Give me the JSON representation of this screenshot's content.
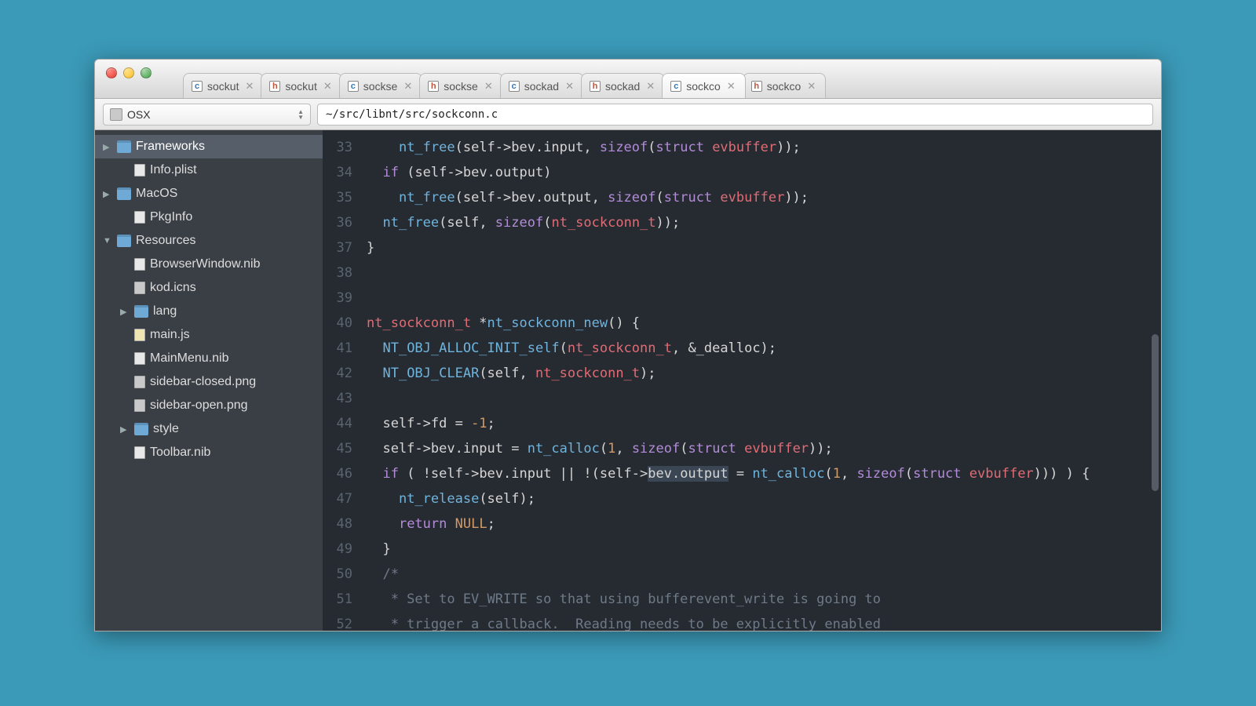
{
  "selector": {
    "label": "OSX"
  },
  "path": "~/src/libnt/src/sockconn.c",
  "tabs": [
    {
      "label": "sockut",
      "type": "c",
      "active": false
    },
    {
      "label": "sockut",
      "type": "h",
      "active": false
    },
    {
      "label": "sockse",
      "type": "c",
      "active": false
    },
    {
      "label": "sockse",
      "type": "h",
      "active": false
    },
    {
      "label": "sockad",
      "type": "c",
      "active": false
    },
    {
      "label": "sockad",
      "type": "h",
      "active": false
    },
    {
      "label": "sockco",
      "type": "c",
      "active": true
    },
    {
      "label": "sockco",
      "type": "h",
      "active": false
    }
  ],
  "sidebar": [
    {
      "label": "Frameworks",
      "kind": "folder",
      "depth": 0,
      "arrow": "right",
      "selected": true
    },
    {
      "label": "Info.plist",
      "kind": "file",
      "depth": 1,
      "arrow": ""
    },
    {
      "label": "MacOS",
      "kind": "folder",
      "depth": 0,
      "arrow": "right"
    },
    {
      "label": "PkgInfo",
      "kind": "file",
      "depth": 1,
      "arrow": ""
    },
    {
      "label": "Resources",
      "kind": "folder",
      "depth": 0,
      "arrow": "down"
    },
    {
      "label": "BrowserWindow.nib",
      "kind": "file",
      "depth": 1,
      "arrow": ""
    },
    {
      "label": "kod.icns",
      "kind": "filedark",
      "depth": 1,
      "arrow": ""
    },
    {
      "label": "lang",
      "kind": "folder",
      "depth": 1,
      "arrow": "right"
    },
    {
      "label": "main.js",
      "kind": "js",
      "depth": 1,
      "arrow": ""
    },
    {
      "label": "MainMenu.nib",
      "kind": "file",
      "depth": 1,
      "arrow": ""
    },
    {
      "label": "sidebar-closed.png",
      "kind": "filedark",
      "depth": 1,
      "arrow": ""
    },
    {
      "label": "sidebar-open.png",
      "kind": "filedark",
      "depth": 1,
      "arrow": ""
    },
    {
      "label": "style",
      "kind": "folder",
      "depth": 1,
      "arrow": "right"
    },
    {
      "label": "Toolbar.nib",
      "kind": "file",
      "depth": 1,
      "arrow": ""
    }
  ],
  "gutter_start": 33,
  "code_lines": [
    "    <span class='c-fn'>nt_free</span>(self-&gt;bev.input, <span class='c-kw'>sizeof</span>(<span class='c-kw'>struct</span> <span class='c-tp'>evbuffer</span>));",
    "  <span class='c-kw'>if</span> (self-&gt;bev.output)",
    "    <span class='c-fn'>nt_free</span>(self-&gt;bev.output, <span class='c-kw'>sizeof</span>(<span class='c-kw'>struct</span> <span class='c-tp'>evbuffer</span>));",
    "  <span class='c-fn'>nt_free</span>(self, <span class='c-kw'>sizeof</span>(<span class='c-tp'>nt_sockconn_t</span>));",
    "}",
    "",
    "",
    "<span class='c-tp'>nt_sockconn_t</span> *<span class='c-fn'>nt_sockconn_new</span>() {",
    "  <span class='c-fn'>NT_OBJ_ALLOC_INIT_self</span>(<span class='c-tp'>nt_sockconn_t</span>, &amp;_dealloc);",
    "  <span class='c-fn'>NT_OBJ_CLEAR</span>(self, <span class='c-tp'>nt_sockconn_t</span>);",
    "",
    "  self-&gt;fd = <span class='c-num'>-1</span>;",
    "  self-&gt;bev.input = <span class='c-fn'>nt_calloc</span>(<span class='c-num'>1</span>, <span class='c-kw'>sizeof</span>(<span class='c-kw'>struct</span> <span class='c-tp'>evbuffer</span>));",
    "  <span class='c-kw'>if</span> ( !self-&gt;bev.input || !(self-&gt;<span class='c-hl'>bev.output</span> = <span class='c-fn'>nt_calloc</span>(<span class='c-num'>1</span>, <span class='c-kw'>sizeof</span>(<span class='c-kw'>struct</span> <span class='c-tp'>evbuffer</span>))) ) {",
    "    <span class='c-fn'>nt_release</span>(self);",
    "    <span class='c-kw'>return</span> <span class='c-num'>NULL</span>;",
    "  }",
    "  <span class='c-cm'>/*</span>",
    "<span class='c-cm'>   * Set to EV_WRITE so that using bufferevent_write is going to</span>",
    "<span class='c-cm'>   * trigger a callback.  Reading needs to be explicitly enabled</span>"
  ]
}
